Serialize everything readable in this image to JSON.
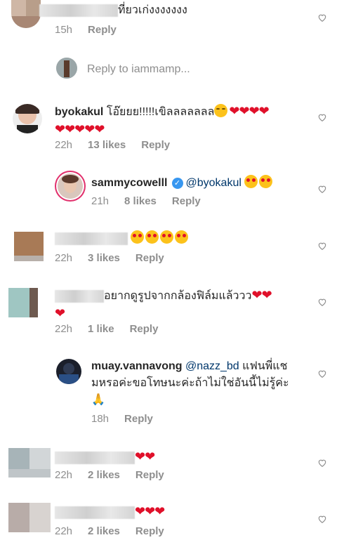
{
  "comments": [
    {
      "text": "ที่ยวเก่งงงงงงง",
      "time": "15h",
      "reply": "Reply"
    },
    {
      "reply_prompt": "Reply to iammamp..."
    },
    {
      "username": "byokakul",
      "text": "โอ๊ยยย!!!!!เขิลลลลลลล",
      "time": "22h",
      "likes": "13 likes",
      "reply": "Reply"
    },
    {
      "username": "sammycowelll",
      "mention": "@byokakul",
      "time": "21h",
      "likes": "8 likes",
      "reply": "Reply"
    },
    {
      "time": "22h",
      "likes": "3 likes",
      "reply": "Reply"
    },
    {
      "text": "อยากดูรูปจากกล้องฟิล์มแล้ววว",
      "time": "22h",
      "likes": "1 like",
      "reply": "Reply"
    },
    {
      "username": "muay.vannavong",
      "mention": "@nazz_bd",
      "text_line1": "แฟนพี่แช",
      "text_line2": "มหรอค่ะขอโทษนะค่ะถ้าไม่ใช่อันนี้ไม่รู้ค่ะ",
      "time": "18h",
      "reply": "Reply"
    },
    {
      "time": "22h",
      "likes": "2 likes",
      "reply": "Reply"
    },
    {
      "time": "22h",
      "likes": "2 likes",
      "reply": "Reply"
    }
  ],
  "colors": {
    "heart": "#e0102a",
    "meta": "#8e8e8e",
    "mention": "#00376b",
    "verified": "#3897f0"
  }
}
